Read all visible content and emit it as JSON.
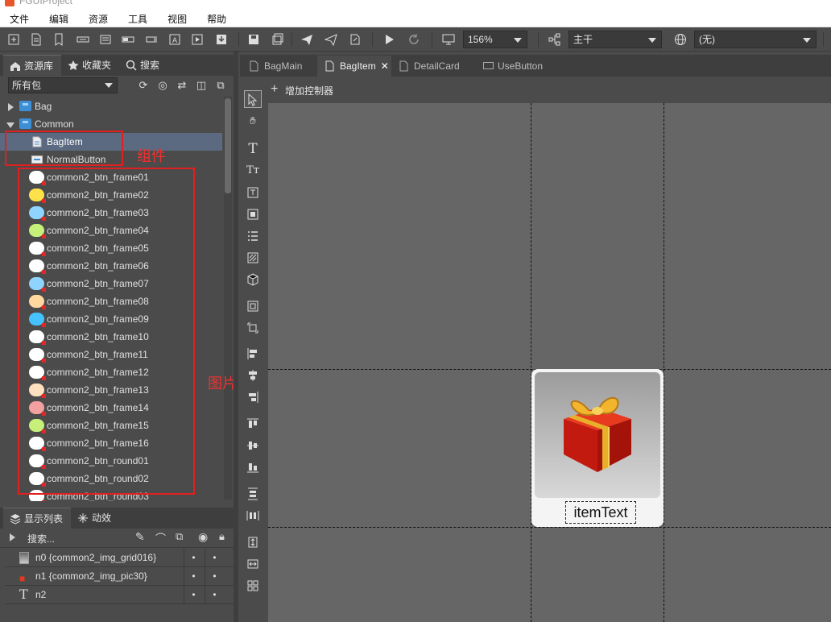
{
  "app": {
    "title": "FGUIProject"
  },
  "menu": [
    "文件",
    "编辑",
    "资源",
    "工具",
    "视图",
    "帮助"
  ],
  "toolbar": {
    "zoom": "156%",
    "branch": "主干",
    "language": "(无)"
  },
  "left_tabs": [
    {
      "label": "资源库",
      "icon": "home-icon"
    },
    {
      "label": "收藏夹",
      "icon": "star-icon"
    },
    {
      "label": "搜索",
      "icon": "search-icon"
    }
  ],
  "package_select": "所有包",
  "tree": {
    "folders": [
      {
        "name": "Bag",
        "expanded": false
      },
      {
        "name": "Common",
        "expanded": true
      }
    ],
    "components": [
      {
        "name": "BagItem",
        "selected": true
      },
      {
        "name": "NormalButton",
        "selected": false
      }
    ],
    "images": [
      {
        "name": "common2_btn_frame01",
        "color": "#ffffff"
      },
      {
        "name": "common2_btn_frame02",
        "color": "#ffe24a"
      },
      {
        "name": "common2_btn_frame03",
        "color": "#8fd3ff"
      },
      {
        "name": "common2_btn_frame04",
        "color": "#c6f07a"
      },
      {
        "name": "common2_btn_frame05",
        "color": "#ffffff"
      },
      {
        "name": "common2_btn_frame06",
        "color": "#ffffff"
      },
      {
        "name": "common2_btn_frame07",
        "color": "#8fd3ff"
      },
      {
        "name": "common2_btn_frame08",
        "color": "#ffd8a0"
      },
      {
        "name": "common2_btn_frame09",
        "color": "#46c2ff"
      },
      {
        "name": "common2_btn_frame10",
        "color": "#ffffff"
      },
      {
        "name": "common2_btn_frame11",
        "color": "#ffffff"
      },
      {
        "name": "common2_btn_frame12",
        "color": "#ffffff"
      },
      {
        "name": "common2_btn_frame13",
        "color": "#ffe0c0"
      },
      {
        "name": "common2_btn_frame14",
        "color": "#f2a0a0"
      },
      {
        "name": "common2_btn_frame15",
        "color": "#c6f07a"
      },
      {
        "name": "common2_btn_frame16",
        "color": "#ffffff"
      },
      {
        "name": "common2_btn_round01",
        "color": "#ffffff"
      },
      {
        "name": "common2_btn_round02",
        "color": "#ffffff"
      },
      {
        "name": "common2_btn_round03",
        "color": "#ffffff"
      }
    ]
  },
  "annotations": {
    "components": "组件",
    "images": "图片"
  },
  "display_tabs": [
    {
      "label": "显示列表",
      "icon": "layers-icon"
    },
    {
      "label": "动效",
      "icon": "effect-icon"
    }
  ],
  "display_search_placeholder": "搜索...",
  "display_list": [
    {
      "label": "n0 {common2_img_grid016}",
      "icon": "image-icon"
    },
    {
      "label": "n1 {common2_img_pic30}",
      "icon": "gift-icon"
    },
    {
      "label": "n2",
      "icon": "text-icon"
    }
  ],
  "doc_tabs": [
    {
      "label": "BagMain",
      "active": false
    },
    {
      "label": "BagItem",
      "active": true
    },
    {
      "label": "DetailCard",
      "active": false
    },
    {
      "label": "UseButton",
      "active": false
    }
  ],
  "controller_add": "增加控制器",
  "canvas": {
    "item_text": "itemText"
  },
  "colors": {
    "bg": "#4b4b4b",
    "selection": "#5b6a80",
    "annotation_red": "#e02020",
    "canvas": "#666666"
  }
}
